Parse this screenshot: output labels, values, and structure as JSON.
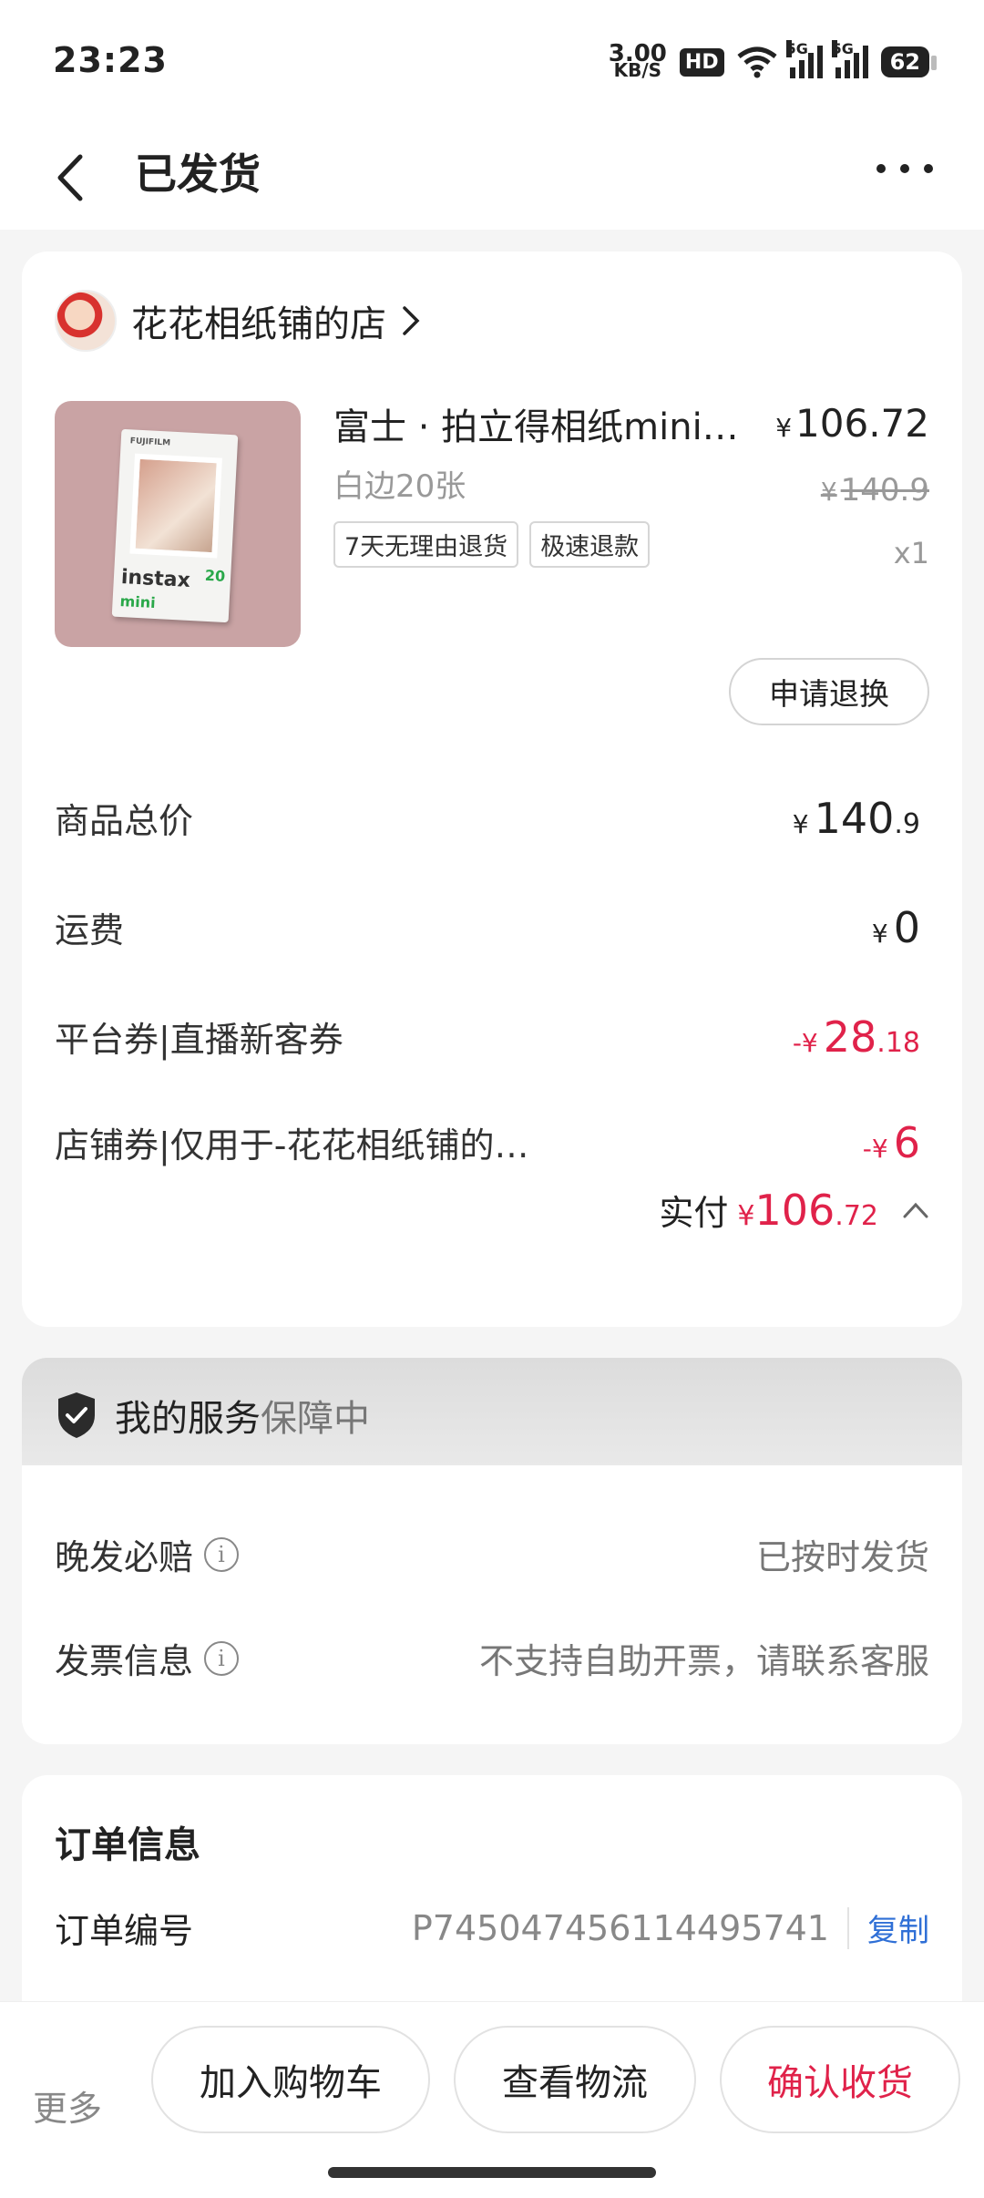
{
  "status_bar": {
    "time": "23:23",
    "net_speed_value": "3.00",
    "net_speed_unit": "KB/S",
    "hd_label": "HD",
    "signal_1_tag": "5G",
    "signal_2_tag": "5G",
    "battery": "62"
  },
  "header": {
    "title": "已发货"
  },
  "shop": {
    "name": "花花相纸铺的店"
  },
  "product": {
    "image_brand": "instax",
    "image_sub": "mini",
    "image_count": "20",
    "image_maker": "FUJIFILM",
    "title": "富士 · 拍立得相纸mini…",
    "spec": "白边20张",
    "tags": [
      "7天无理由退货",
      "极速退款"
    ],
    "price_yen": "¥",
    "price": "106.72",
    "original_price": "140.9",
    "quantity": "x1",
    "return_button": "申请退换"
  },
  "fees": {
    "goods_total_label": "商品总价",
    "goods_total_yen": "¥",
    "goods_total_int": "140",
    "goods_total_dec": ".9",
    "shipping_label": "运费",
    "shipping_yen": "¥",
    "shipping_value": "0",
    "platform_coupon_label": "平台券|直播新客券",
    "platform_coupon_prefix": "-¥",
    "platform_coupon_int": "28",
    "platform_coupon_dec": ".18",
    "shop_coupon_label": "店铺券|仅用于-花花相纸铺的…",
    "shop_coupon_prefix": "-¥",
    "shop_coupon_value": "6",
    "paid_label": "实付",
    "paid_yen": "¥",
    "paid_int": "106",
    "paid_dec": ".72"
  },
  "service": {
    "title_main": "我的服务",
    "title_status": "保障中",
    "rows": [
      {
        "label": "晚发必赔",
        "value": "已按时发货"
      },
      {
        "label": "发票信息",
        "value": "不支持自助开票，请联系客服"
      }
    ]
  },
  "order_info": {
    "title": "订单信息",
    "number_label": "订单编号",
    "number_value": "P745047456114495741",
    "copy_label": "复制"
  },
  "bottom_bar": {
    "more": "更多",
    "add_cart": "加入购物车",
    "view_logistics": "查看物流",
    "confirm_receipt": "确认收货"
  },
  "colors": {
    "accent_red": "#e0224a",
    "link_blue": "#2f6fd6"
  },
  "icons": [
    "back-icon",
    "more-icon",
    "chevron-right-icon",
    "chevron-up-icon",
    "shield-icon",
    "info-icon",
    "wifi-icon",
    "signal-icon",
    "battery-icon"
  ]
}
